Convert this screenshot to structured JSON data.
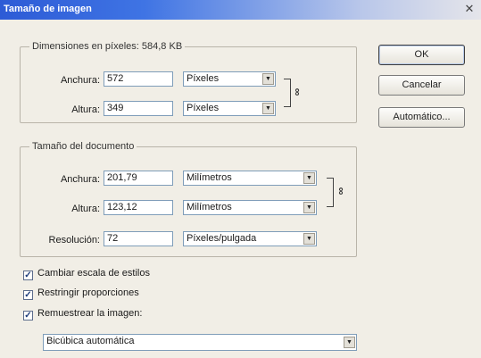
{
  "window": {
    "title": "Tamaño de imagen"
  },
  "pixel_dimensions": {
    "legend": "Dimensiones en píxeles: 584,8 KB",
    "width": {
      "label": "Anchura:",
      "value": "572",
      "unit": "Píxeles"
    },
    "height": {
      "label": "Altura:",
      "value": "349",
      "unit": "Píxeles"
    }
  },
  "document_size": {
    "legend": "Tamaño del documento",
    "width": {
      "label": "Anchura:",
      "value": "201,79",
      "unit": "Milímetros"
    },
    "height": {
      "label": "Altura:",
      "value": "123,12",
      "unit": "Milímetros"
    },
    "resolution": {
      "label": "Resolución:",
      "value": "72",
      "unit": "Píxeles/pulgada"
    }
  },
  "buttons": {
    "ok": "OK",
    "cancel": "Cancelar",
    "auto": "Automático..."
  },
  "options": {
    "scale_styles": {
      "label": "Cambiar escala de estilos",
      "checked": true
    },
    "constrain": {
      "label": "Restringir proporciones",
      "checked": true
    },
    "resample": {
      "label": "Remuestrear la imagen:",
      "checked": true
    },
    "method": "Bicúbica automática"
  },
  "icons": {
    "close": "close-icon",
    "link": "chain-link-icon",
    "dropdown": "chevron-down-icon",
    "check": "checkmark-icon"
  }
}
